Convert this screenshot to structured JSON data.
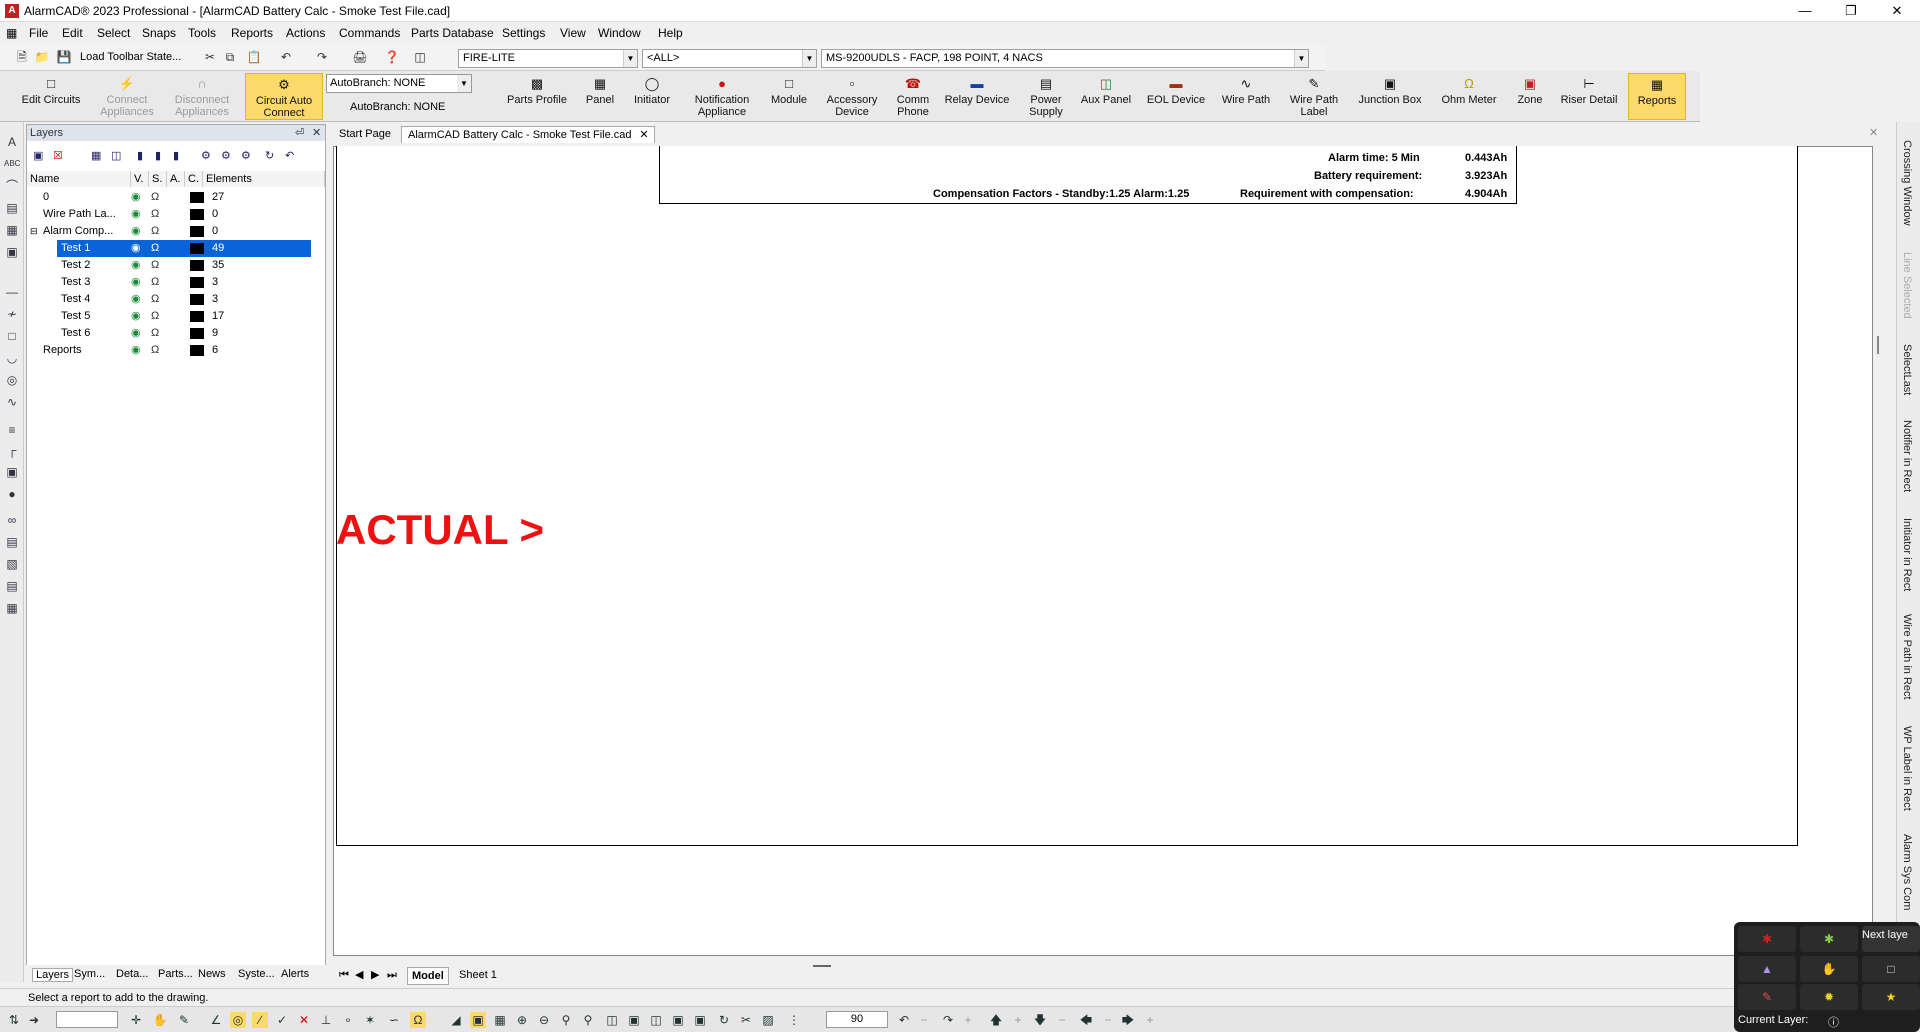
{
  "window": {
    "title": "AlarmCAD® 2023 Professional - [AlarmCAD Battery Calc - Smoke Test File.cad]"
  },
  "menu": [
    "File",
    "Edit",
    "Select",
    "Snaps",
    "Tools",
    "Reports",
    "Actions",
    "Commands",
    "Parts Database",
    "Settings",
    "View",
    "Window",
    "Help"
  ],
  "toolbar1": {
    "load_state_label": "Load Toolbar State...",
    "manufacturer": "FIRE-LITE",
    "filter": "<ALL>",
    "panel_model": "MS-9200UDLS - FACP, 198 POINT, 4 NACS"
  },
  "ribbon": {
    "edit_circuits": "Edit Circuits",
    "connect_appliances": "Connect Appliances",
    "disconnect_appliances": "Disconnect Appliances",
    "circuit_auto_connect": "Circuit Auto Connect",
    "autobranch_combo": "AutoBranch: NONE",
    "autobranch_label": "AutoBranch: NONE",
    "parts_profile": "Parts Profile",
    "panel": "Panel",
    "initiator": "Initiator",
    "notification_appliance": "Notification Appliance",
    "module": "Module",
    "accessory_device": "Accessory Device",
    "comm_phone": "Comm Phone",
    "relay_device": "Relay Device",
    "power_supply": "Power Supply",
    "aux_panel": "Aux Panel",
    "eol_device": "EOL Device",
    "wire_path": "Wire Path",
    "wire_path_label": "Wire Path Label",
    "junction_box": "Junction Box",
    "ohm_meter": "Ohm Meter",
    "zone": "Zone",
    "riser_detail": "Riser Detail",
    "reports": "Reports"
  },
  "layers_panel": {
    "title": "Layers",
    "columns": {
      "name": "Name",
      "v": "V.",
      "s": "S.",
      "a": "A.",
      "c": "C.",
      "elements": "Elements"
    },
    "rows": [
      {
        "name": "0",
        "elements": "27"
      },
      {
        "name": "Wire Path La...",
        "elements": "0"
      },
      {
        "name": "Alarm Comp...",
        "elements": "0"
      },
      {
        "name": "Test 1",
        "elements": "49"
      },
      {
        "name": "Test 2",
        "elements": "35"
      },
      {
        "name": "Test 3",
        "elements": "3"
      },
      {
        "name": "Test 4",
        "elements": "3"
      },
      {
        "name": "Test 5",
        "elements": "17"
      },
      {
        "name": "Test 6",
        "elements": "9"
      },
      {
        "name": "Reports",
        "elements": "6"
      }
    ],
    "tabs": [
      "Layers",
      "Sym...",
      "Deta...",
      "Parts...",
      "News",
      "Syste...",
      "Alerts"
    ]
  },
  "doc_tabs": {
    "start": "Start Page",
    "active": "AlarmCAD Battery Calc - Smoke Test File.cad"
  },
  "report": {
    "alarm_time_label": "Alarm time: 5 Min",
    "alarm_time_value": "0.443Ah",
    "battery_req_label": "Battery requirement:",
    "battery_req_value": "3.923Ah",
    "comp_factors": "Compensation Factors - Standby:1.25   Alarm:1.25",
    "req_comp_label": "Requirement with compensation:",
    "req_comp_value": "4.904Ah"
  },
  "actual_label": "ACTUAL >",
  "sheet_tabs": {
    "model": "Model",
    "sheet1": "Sheet 1"
  },
  "right_tabs": [
    "Crossing Window",
    "Line Selected",
    "SelectLast",
    "Notifier in Rect",
    "Initiator in Rect",
    "Wire Path in Rect",
    "WP Label in Rect",
    "Alarm Sys Com"
  ],
  "status": {
    "message": "Select a report to add to the drawing."
  },
  "bottom_toolbar": {
    "rotation": "90"
  },
  "overlay": {
    "next_layer": "Next laye",
    "current_layer": "Current Layer:"
  }
}
